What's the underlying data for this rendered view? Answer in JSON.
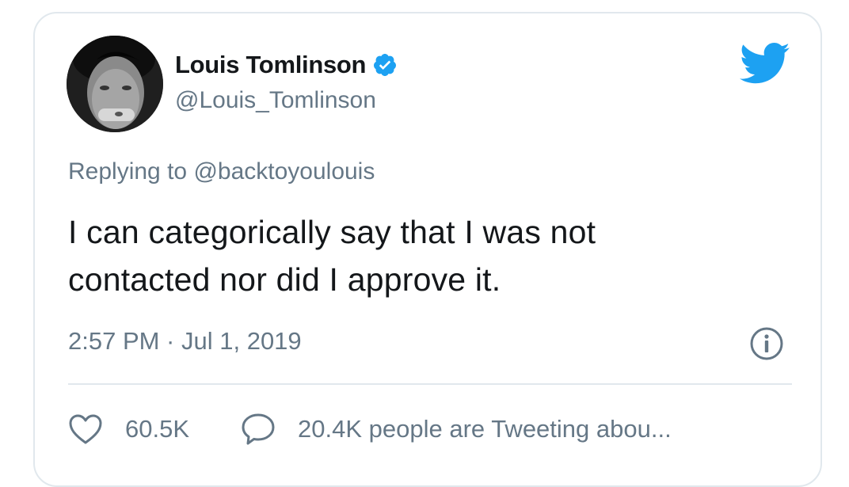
{
  "author": {
    "display_name": "Louis Tomlinson",
    "handle": "@Louis_Tomlinson",
    "verified": true
  },
  "reply": {
    "prefix": "Replying to ",
    "handle": "@backtoyoulouis"
  },
  "tweet": {
    "text_line1": "I can categorically say that I was not",
    "text_line2": "contacted nor did I approve it.",
    "timestamp": "2:57 PM · Jul 1, 2019"
  },
  "stats": {
    "likes": "60.5K",
    "conversation": "20.4K people are Tweeting abou..."
  },
  "colors": {
    "accent": "#1da1f2",
    "text": "#14171a",
    "muted": "#657786",
    "border": "#e1e8ed"
  },
  "icons": {
    "verified": "verified-badge-icon",
    "brand": "twitter-bird-icon",
    "info": "info-icon",
    "like": "heart-icon",
    "reply": "speech-bubble-icon"
  }
}
